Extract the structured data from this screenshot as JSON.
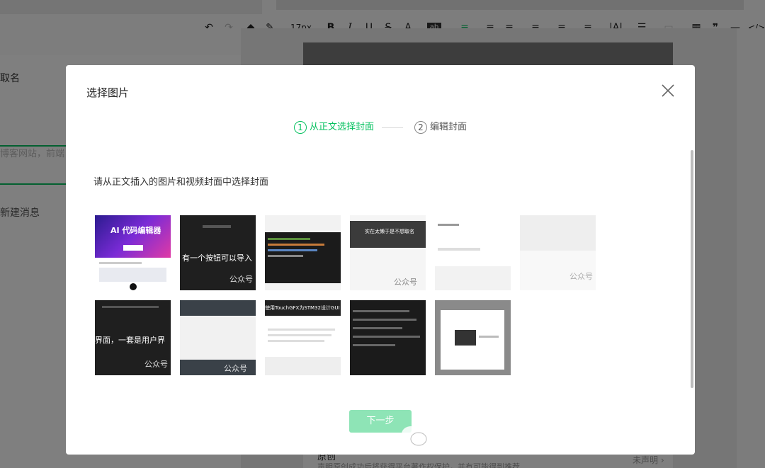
{
  "toolbar": {
    "font_size": "17px",
    "items": [
      "undo-icon",
      "redo-icon",
      "format-painter-icon",
      "clear-format-icon",
      "bold-icon",
      "italic-icon",
      "underline-icon",
      "strikethrough-icon",
      "font-color-icon",
      "background-color-icon",
      "align-left-icon",
      "indent-icon",
      "line-spacing-icon",
      "list-icon",
      "table-icon",
      "quote-icon",
      "divider-icon",
      "code-icon"
    ]
  },
  "background": {
    "left_title": "取名",
    "left_placeholder": "博客网站，前端",
    "left_new_message": "新建消息",
    "bottom_label": "原创",
    "bottom_text": "声明原创成功后将获得平台著作权保护，并有可能得到推荐",
    "bottom_right": "未声明 ›"
  },
  "dialog": {
    "title": "选择图片",
    "steps": [
      {
        "num": "1",
        "label": "从正文选择封面"
      },
      {
        "num": "2",
        "label": "编辑封面"
      }
    ],
    "instruction": "请从正文插入的图片和视频封面中选择封面",
    "next_button": "下一步"
  },
  "thumbnails": [
    {
      "title": "AI 代码编辑器"
    },
    {
      "title": "有一个按钮可以导入"
    },
    {
      "title": ""
    },
    {
      "title": "实在太懒于是不想取名"
    },
    {
      "title": ""
    },
    {
      "title": ""
    },
    {
      "title": "界面，一套是用户界"
    },
    {
      "title": ""
    },
    {
      "title": "使用TouchGFX为STM32设计GUI"
    },
    {
      "title": ""
    },
    {
      "title": ""
    }
  ],
  "thumb_watermark": "公众号",
  "watermark": "公众号 · 实在太懒于是不想取名",
  "colors": {
    "accent": "#07c160",
    "button_disabled": "#8ee4b6"
  }
}
